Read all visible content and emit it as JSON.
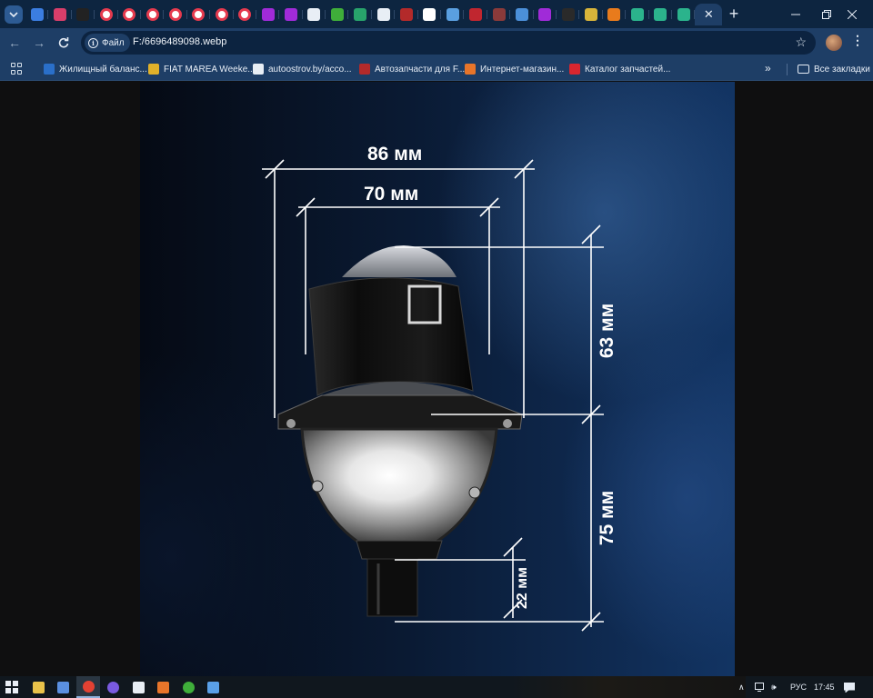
{
  "browser": {
    "tabs": [
      {
        "label": "",
        "icon": "check-shield-icon",
        "color": "#3b7de0"
      },
      {
        "label": "",
        "icon": "pink-square-icon",
        "color": "#d83e6a"
      },
      {
        "label": "",
        "icon": "black-face-icon",
        "color": "#222222"
      },
      {
        "label": "",
        "icon": "red-ring-icon",
        "color": "#e53a4e"
      },
      {
        "label": "",
        "icon": "red-ring-icon",
        "color": "#e53a4e"
      },
      {
        "label": "",
        "icon": "red-ring-icon",
        "color": "#e53a4e"
      },
      {
        "label": "",
        "icon": "red-ring-icon",
        "color": "#e53a4e"
      },
      {
        "label": "",
        "icon": "red-ring-icon",
        "color": "#e53a4e"
      },
      {
        "label": "",
        "icon": "red-ring-icon",
        "color": "#e53a4e"
      },
      {
        "label": "",
        "icon": "red-ring-icon",
        "color": "#e53a4e"
      },
      {
        "label": "",
        "icon": "wildberries-icon",
        "color": "#a02bd8"
      },
      {
        "label": "",
        "icon": "wildberries-icon",
        "color": "#a02bd8"
      },
      {
        "label": "",
        "icon": "autoostrov-icon",
        "color": "#e8eef5"
      },
      {
        "label": "",
        "icon": "green-square-icon",
        "color": "#3fae3a"
      },
      {
        "label": "",
        "icon": "green-cross-icon",
        "color": "#28a36b"
      },
      {
        "label": "",
        "icon": "autoostrov-icon",
        "color": "#e8eef5"
      },
      {
        "label": "",
        "icon": "red-parts-icon",
        "color": "#b32a2a"
      },
      {
        "label": "",
        "icon": "google-icon",
        "color": "#ffffff"
      },
      {
        "label": "",
        "icon": "blue-globe-icon",
        "color": "#5a9fe0"
      },
      {
        "label": "",
        "icon": "red-led-icon",
        "color": "#c0262f"
      },
      {
        "label": "",
        "icon": "ks-icon",
        "color": "#8a3a3a"
      },
      {
        "label": "",
        "icon": "blue-globe-icon",
        "color": "#4b8fd8"
      },
      {
        "label": "",
        "icon": "wildberries-icon",
        "color": "#a02bd8"
      },
      {
        "label": "",
        "icon": "dark-square-icon",
        "color": "#2a2a2a"
      },
      {
        "label": "",
        "icon": "yellow-square-icon",
        "color": "#d7b43a"
      },
      {
        "label": "",
        "icon": "orange-p-icon",
        "color": "#e87b1c"
      },
      {
        "label": "",
        "icon": "teal-search-icon",
        "color": "#2bb38c"
      },
      {
        "label": "",
        "icon": "teal-search-icon",
        "color": "#2bb38c"
      },
      {
        "label": "",
        "icon": "teal-search-icon",
        "color": "#2bb38c"
      }
    ],
    "address": {
      "chip_label": "Файл",
      "url": "F:/6696489098.webp"
    },
    "bookmarks": [
      {
        "label": "Жилищный баланс...",
        "color": "#2a6fc9"
      },
      {
        "label": "FIAT MAREA Weeke...",
        "color": "#e0b12a"
      },
      {
        "label": "autoostrov.by/acco...",
        "color": "#e8eef5"
      },
      {
        "label": "Автозапчасти для F...",
        "color": "#b32a2a"
      },
      {
        "label": "Интернет-магазин...",
        "color": "#e8752a"
      },
      {
        "label": "Каталог запчастей...",
        "color": "#d8262f"
      }
    ],
    "all_bookmarks_label": "Все закладки"
  },
  "image": {
    "dimensions": [
      {
        "label": "86 мм"
      },
      {
        "label": "70 мм"
      },
      {
        "label": "63 мм"
      },
      {
        "label": "75 мм"
      },
      {
        "label": "22 мм"
      }
    ]
  },
  "taskbar": {
    "apps": [
      {
        "icon": "file-explorer-icon",
        "color": "#e9c24a"
      },
      {
        "icon": "save-app-icon",
        "color": "#5a8fe0"
      },
      {
        "icon": "chrome-icon",
        "color": "#e34133",
        "active": true
      },
      {
        "icon": "firefox-icon",
        "color": "#7a5ae0"
      },
      {
        "icon": "photo-app-icon",
        "color": "#e8eef5"
      },
      {
        "icon": "avast-icon",
        "color": "#e8752a"
      },
      {
        "icon": "green-app-icon",
        "color": "#3fae3a"
      },
      {
        "icon": "blue-app-icon",
        "color": "#5aa0e8"
      }
    ],
    "language": "РУС",
    "time": "17:45"
  }
}
